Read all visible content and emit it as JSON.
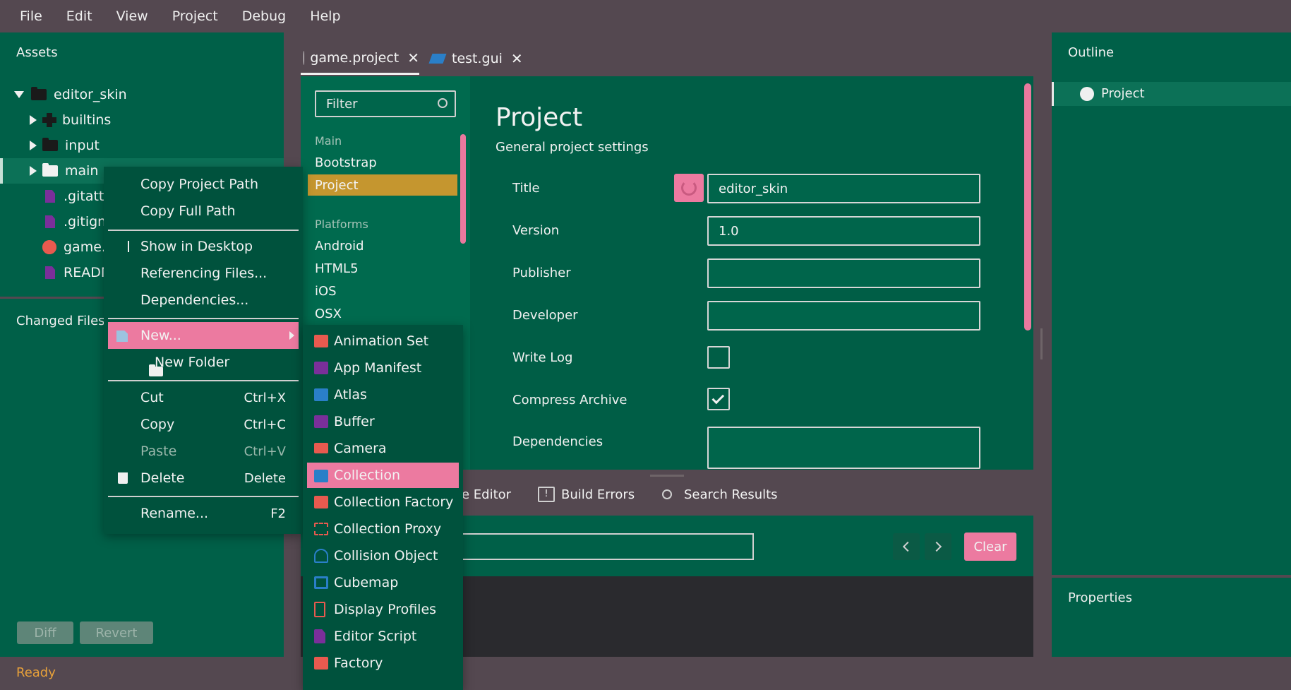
{
  "menu": [
    "File",
    "Edit",
    "View",
    "Project",
    "Debug",
    "Help"
  ],
  "assets": {
    "title": "Assets",
    "tree": [
      {
        "label": "editor_skin",
        "icon": "folder-icon"
      },
      {
        "label": "builtins",
        "icon": "puzzle-icon"
      },
      {
        "label": "input",
        "icon": "folder-icon"
      },
      {
        "label": "main",
        "icon": "folder-icon"
      },
      {
        "label": ".gitattr",
        "icon": "file-icon"
      },
      {
        "label": ".gitignc",
        "icon": "file-icon"
      },
      {
        "label": "game.p",
        "icon": "gear-icon"
      },
      {
        "label": "READM",
        "icon": "file-icon"
      }
    ]
  },
  "changed_files": {
    "title": "Changed Files",
    "diff": "Diff",
    "revert": "Revert"
  },
  "tabs": [
    {
      "label": "game.project",
      "close": "✕"
    },
    {
      "label": "test.gui",
      "close": "✕"
    }
  ],
  "editor_side": {
    "filter_placeholder": "Filter",
    "groups": [
      {
        "head": "Main",
        "items": [
          "Bootstrap",
          "Project"
        ]
      },
      {
        "head": "Platforms",
        "items": [
          "Android",
          "HTML5",
          "iOS",
          "OSX"
        ]
      }
    ]
  },
  "form": {
    "title": "Project",
    "subtitle": "General project settings",
    "fields": [
      {
        "label": "Title",
        "value": "editor_skin"
      },
      {
        "label": "Version",
        "value": "1.0"
      },
      {
        "label": "Publisher",
        "value": ""
      },
      {
        "label": "Developer",
        "value": ""
      },
      {
        "label": "Write Log",
        "checked": false
      },
      {
        "label": "Compress Archive",
        "checked": true
      },
      {
        "label": "Dependencies",
        "value": ""
      }
    ]
  },
  "bottom": {
    "tabs": [
      "e Editor",
      "Build Errors",
      "Search Results"
    ],
    "clear": "Clear"
  },
  "outline": {
    "title": "Outline",
    "item": "Project"
  },
  "properties": {
    "title": "Properties"
  },
  "status": "Ready",
  "context_menu": [
    {
      "label": "Copy Project Path"
    },
    {
      "label": "Copy Full Path"
    },
    {
      "label": "Show in Desktop"
    },
    {
      "label": "Referencing Files..."
    },
    {
      "label": "Dependencies..."
    },
    {
      "label": "New..."
    },
    {
      "label": "New Folder"
    },
    {
      "label": "Cut",
      "shortcut": "Ctrl+X"
    },
    {
      "label": "Copy",
      "shortcut": "Ctrl+C"
    },
    {
      "label": "Paste",
      "shortcut": "Ctrl+V"
    },
    {
      "label": "Delete",
      "shortcut": "Delete"
    },
    {
      "label": "Rename...",
      "shortcut": "F2"
    }
  ],
  "new_submenu": [
    {
      "label": "Animation Set",
      "color": "#e85a4f"
    },
    {
      "label": "App Manifest",
      "color": "#7a2f9a"
    },
    {
      "label": "Atlas",
      "color": "#2a7fc8"
    },
    {
      "label": "Buffer",
      "color": "#7a2f9a"
    },
    {
      "label": "Camera",
      "color": "#e85a4f"
    },
    {
      "label": "Collection",
      "color": "#2a7fc8"
    },
    {
      "label": "Collection Factory",
      "color": "#e85a4f"
    },
    {
      "label": "Collection Proxy",
      "color": "#e85a4f"
    },
    {
      "label": "Collision Object",
      "color": "#2a7fc8"
    },
    {
      "label": "Cubemap",
      "color": "#2a7fc8"
    },
    {
      "label": "Display Profiles",
      "color": "#e85a4f"
    },
    {
      "label": "Editor Script",
      "color": "#7a2f9a"
    },
    {
      "label": "Factory",
      "color": "#e85a4f"
    }
  ],
  "colors": {
    "accent_pink": "#ec7aa0",
    "selected_orange": "#c5962f",
    "panel_green": "#006048",
    "chrome": "#544850"
  }
}
